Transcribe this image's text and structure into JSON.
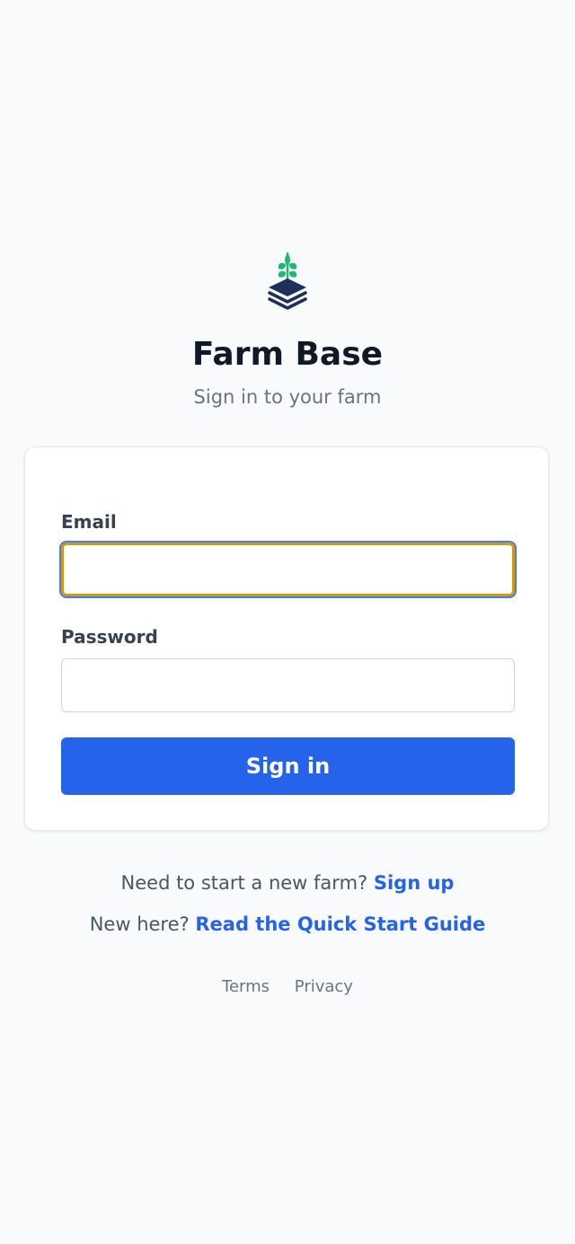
{
  "app": {
    "title": "Farm Base",
    "subtitle": "Sign in to your farm",
    "logo_icon": "farm-layers-sprout-icon"
  },
  "form": {
    "email_label": "Email",
    "email_value": "",
    "password_label": "Password",
    "password_value": "",
    "submit_label": "Sign in"
  },
  "links": {
    "signup_prompt": "Need to start a new farm?",
    "signup_label": "Sign up",
    "guide_prompt": "New here?",
    "guide_label": "Read the Quick Start Guide"
  },
  "footer": {
    "terms_label": "Terms",
    "privacy_label": "Privacy"
  },
  "colors": {
    "accent": "#2563eb",
    "focus_border": "#d89614",
    "logo_navy": "#1e2f5a",
    "logo_green": "#22b573"
  }
}
